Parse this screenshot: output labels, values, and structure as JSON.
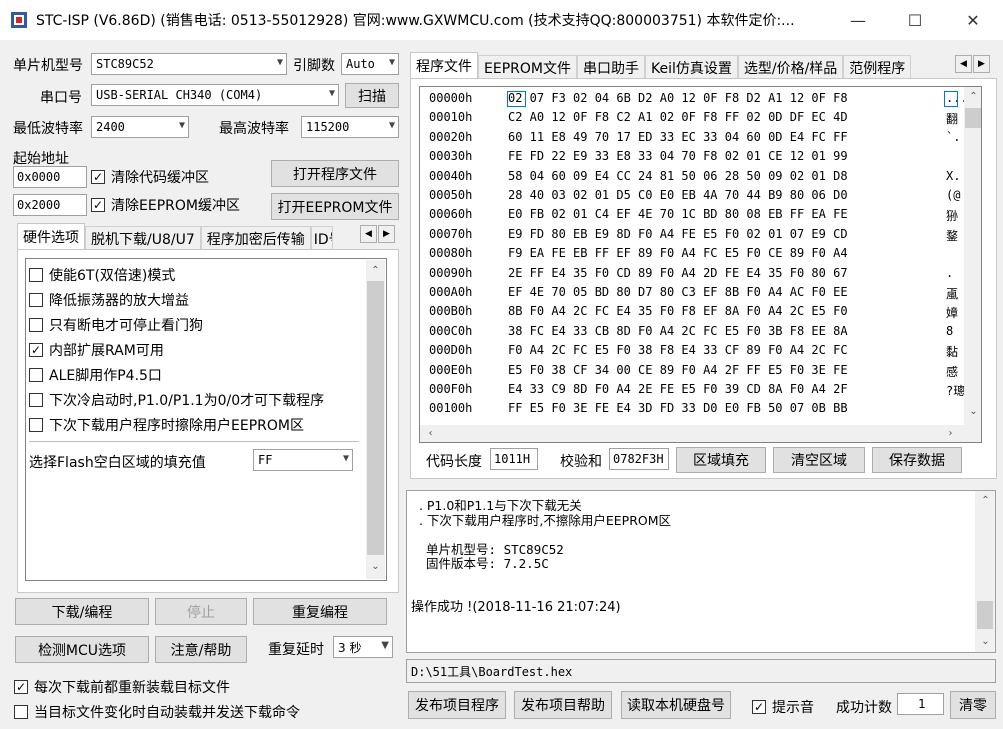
{
  "title": "STC-ISP (V6.86D) (销售电话: 0513-55012928) 官网:www.GXWMCU.com  (技术支持QQ:800003751) 本软件定价:...",
  "window_buttons": {
    "minimize": "—",
    "maximize": "☐",
    "close": "✕"
  },
  "left": {
    "mcu_type_label": "单片机型号",
    "mcu_type_value": "STC89C52",
    "pins_label": "引脚数",
    "pins_value": "Auto",
    "port_label": "串口号",
    "port_value": "USB-SERIAL CH340 (COM4)",
    "scan_button": "扫描",
    "min_baud_label": "最低波特率",
    "min_baud_value": "2400",
    "max_baud_label": "最高波特率",
    "max_baud_value": "115200",
    "start_addr_label": "起始地址",
    "addr1_value": "0x0000",
    "clear_code_label": "清除代码缓冲区",
    "open_prog_button": "打开程序文件",
    "addr2_value": "0x2000",
    "clear_eeprom_label": "清除EEPROM缓冲区",
    "open_eeprom_button": "打开EEPROM文件"
  },
  "hw_tabs": [
    "硬件选项",
    "脱机下载/U8/U7",
    "程序加密后传输",
    "ID号"
  ],
  "hw_options": [
    {
      "label": "使能6T(双倍速)模式",
      "checked": false
    },
    {
      "label": "降低振荡器的放大增益",
      "checked": false
    },
    {
      "label": "只有断电才可停止看门狗",
      "checked": false
    },
    {
      "label": "内部扩展RAM可用",
      "checked": true
    },
    {
      "label": "ALE脚用作P4.5口",
      "checked": false
    },
    {
      "label": "下次冷启动时,P1.0/P1.1为0/0才可下载程序",
      "checked": false
    },
    {
      "label": "下次下载用户程序时擦除用户EEPROM区",
      "checked": false
    }
  ],
  "fill_label": "选择Flash空白区域的填充值",
  "fill_value": "FF",
  "buttons": {
    "download": "下载/编程",
    "stop": "停止",
    "reprogram": "重复编程",
    "check_mcu": "检测MCU选项",
    "help": "注意/帮助",
    "repeat_delay_label": "重复延时",
    "repeat_delay_value": "3 秒"
  },
  "bottom_checks": [
    {
      "label": "每次下载前都重新装载目标文件",
      "checked": true
    },
    {
      "label": "当目标文件变化时自动装载并发送下载命令",
      "checked": false
    }
  ],
  "right_tabs": [
    "程序文件",
    "EEPROM文件",
    "串口助手",
    "Keil仿真设置",
    "选型/价格/样品",
    "范例程序"
  ],
  "hex_rows": [
    {
      "addr": "00000h",
      "bytes": "02 07 F3 02 04 6B D2 A0 12 0F F8 D2 A1 12 0F F8",
      "ascii": "..."
    },
    {
      "addr": "00010h",
      "bytes": "C2 A0 12 0F F8 C2 A1 02 0F F8 FF 02 0D DF EC 4D",
      "ascii": "翻"
    },
    {
      "addr": "00020h",
      "bytes": "60 11 E8 49 70 17 ED 33 EC 33 04 60 0D E4 FC FF",
      "ascii": "`."
    },
    {
      "addr": "00030h",
      "bytes": "FE FD 22 E9 33 E8 33 04 70 F8 02 01 CE 12 01 99",
      "ascii": ""
    },
    {
      "addr": "00040h",
      "bytes": "58 04 60 09 E4 CC 24 81 50 06 28 50 09 02 01 D8",
      "ascii": "X."
    },
    {
      "addr": "00050h",
      "bytes": "28 40 03 02 01 D5 C0 E0 EB 4A 70 44 B9 80 06 D0",
      "ascii": "(@"
    },
    {
      "addr": "00060h",
      "bytes": "E0 FB 02 01 C4 EF 4E 70 1C BD 80 08 EB FF EA FE",
      "ascii": "狲"
    },
    {
      "addr": "00070h",
      "bytes": "E9 FD 80 EB E9 8D F0 A4 FE E5 F0 02 01 07 E9 CD",
      "ascii": "鍪"
    },
    {
      "addr": "00080h",
      "bytes": "F9 EA FE EB FF EF 89 F0 A4 FC E5 F0 CE 89 F0 A4",
      "ascii": ""
    },
    {
      "addr": "00090h",
      "bytes": "2E FF E4 35 F0 CD 89 F0 A4 2D FE E4 35 F0 80 67",
      "ascii": "."
    },
    {
      "addr": "000A0h",
      "bytes": "EF 4E 70 05 BD 80 D7 80 C3 EF 8B F0 A4 AC F0 EE",
      "ascii": "颪"
    },
    {
      "addr": "000B0h",
      "bytes": "8B F0 A4 2C FC E4 35 F0 F8 EF 8A F0 A4 2C E5 F0",
      "ascii": "嫜"
    },
    {
      "addr": "000C0h",
      "bytes": "38 FC E4 33 CB 8D F0 A4 2C FC E5 F0 3B F8 EE 8A",
      "ascii": "8"
    },
    {
      "addr": "000D0h",
      "bytes": "F0 A4 2C FC E5 F0 38 F8 E4 33 CF 89 F0 A4 2C FC",
      "ascii": "黏"
    },
    {
      "addr": "000E0h",
      "bytes": "E5 F0 38 CF 34 00 CE 89 F0 A4 2F FF E5 F0 3E FE",
      "ascii": "感"
    },
    {
      "addr": "000F0h",
      "bytes": "E4 33 C9 8D F0 A4 2E FE E5 F0 39 CD 8A F0 A4 2F",
      "ascii": "?璁"
    },
    {
      "addr": "00100h",
      "bytes": "FF E5 F0 3E FE E4 3D FD 33 D0 E0 FB 50 07 0B BB",
      "ascii": ""
    }
  ],
  "code_len_label": "代码长度",
  "code_len_value": "1011H",
  "checksum_label": "校验和",
  "checksum_value": "0782F3H",
  "right_buttons": {
    "fill_region": "区域填充",
    "clear_region": "清空区域",
    "save_data": "保存数据"
  },
  "log_lines": [
    "  . P1.0和P1.1与下次下载无关",
    "  . 下次下载用户程序时,不擦除用户EEPROM区",
    "",
    "  单片机型号: STC89C52",
    "  固件版本号: 7.2.5C",
    "",
    "",
    "操作成功 !(2018-11-16 21:07:24)"
  ],
  "file_path": "D:\\51工具\\BoardTest.hex",
  "bottom_buttons": {
    "publish_prog": "发布项目程序",
    "publish_help": "发布项目帮助",
    "read_disk": "读取本机硬盘号"
  },
  "prompt_label": "提示音",
  "prompt_checked": true,
  "success_count_label": "成功计数",
  "success_count_value": "1",
  "clear_button": "清零",
  "colors": {
    "accent": "#0078d7",
    "hex_addr": "#000000",
    "log_bg": "#ffffff"
  }
}
